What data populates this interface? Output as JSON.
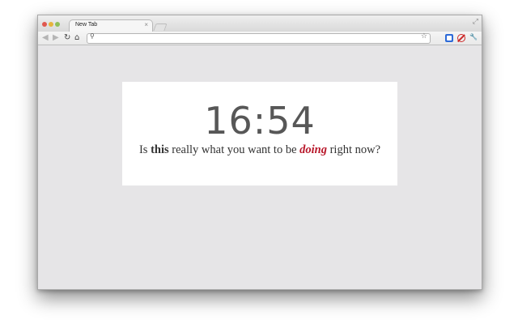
{
  "browser": {
    "tab": {
      "title": "New Tab",
      "close_glyph": "×"
    },
    "toolbar": {
      "back_glyph": "◀",
      "forward_glyph": "▶",
      "reload_glyph": "↻",
      "home_glyph": "⌂",
      "search_glyph": "⚲",
      "star_glyph": "☆",
      "wrench_glyph": "🔧",
      "address_value": ""
    },
    "resize_glyph": "⤢",
    "icons": {
      "traffic_lights": [
        "close-icon",
        "minimize-icon",
        "maximize-icon"
      ],
      "extensions": [
        "extension-blue-icon",
        "extension-blocked-icon"
      ]
    }
  },
  "newtab": {
    "clock": "16:54",
    "message": {
      "part1": "Is ",
      "bold_word": "this",
      "part2": " really what you want to be ",
      "highlight_word": "doing",
      "part3": " right now?"
    }
  },
  "colors": {
    "page_background": "#e6e5e7",
    "card_background": "#ffffff",
    "clock_text": "#575757",
    "highlight": "#b8172a"
  }
}
